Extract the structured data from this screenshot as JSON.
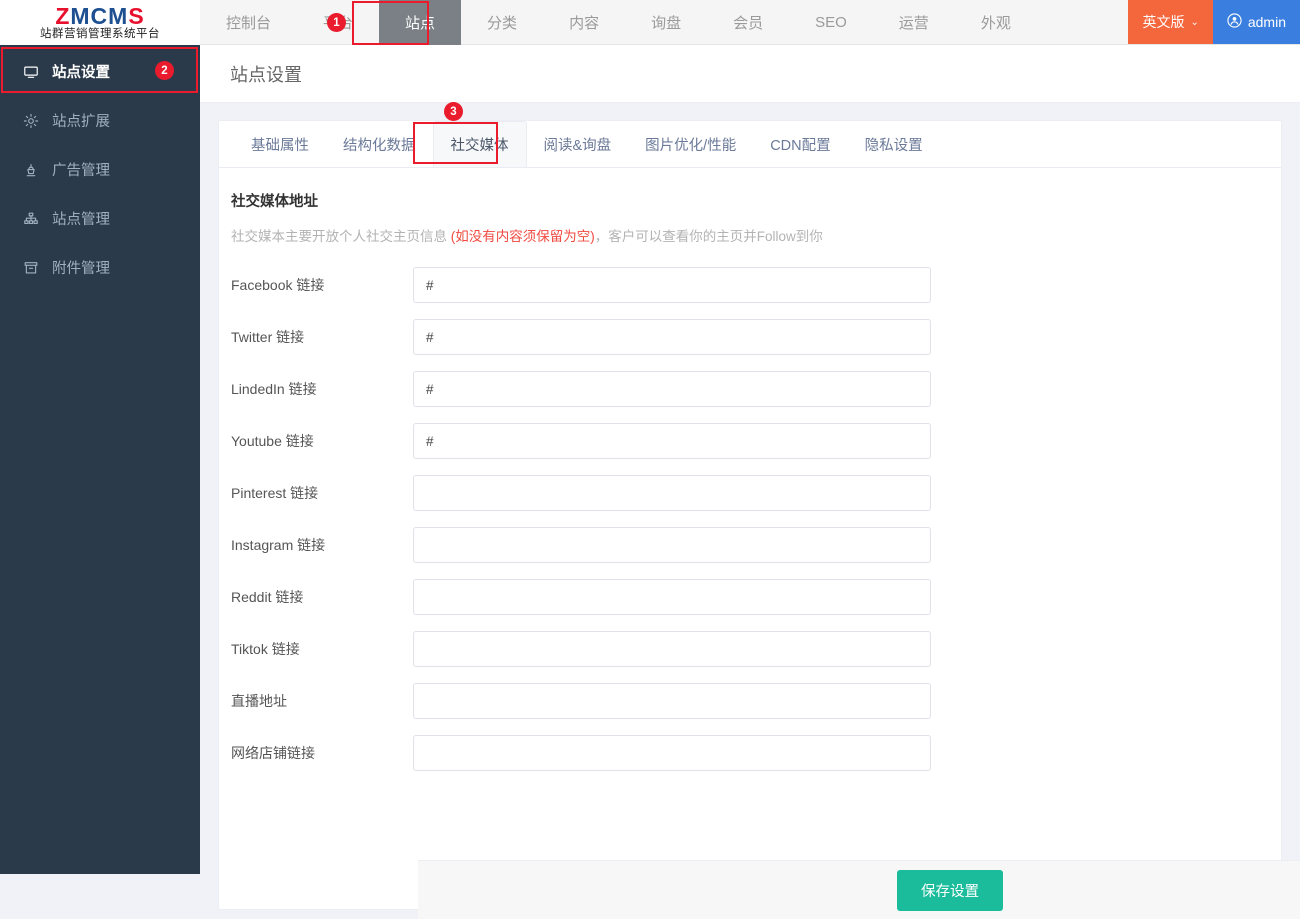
{
  "brand": {
    "logo_z": "Z",
    "logo_mcm": "MCM",
    "logo_s": "S",
    "subtitle": "站群营销管理系统平台"
  },
  "topnav": {
    "items": [
      {
        "label": "控制台",
        "active": false
      },
      {
        "label": "平台",
        "active": false
      },
      {
        "label": "站点",
        "active": true
      },
      {
        "label": "分类",
        "active": false
      },
      {
        "label": "内容",
        "active": false
      },
      {
        "label": "询盘",
        "active": false
      },
      {
        "label": "会员",
        "active": false
      },
      {
        "label": "SEO",
        "active": false
      },
      {
        "label": "运营",
        "active": false
      },
      {
        "label": "外观",
        "active": false
      }
    ],
    "lang_label": "英文版",
    "lang_caret": "⌄",
    "user_label": "admin",
    "user_icon": "user-circle-icon"
  },
  "sidebar": {
    "items": [
      {
        "label": "站点设置",
        "icon": "monitor-icon",
        "active": true
      },
      {
        "label": "站点扩展",
        "icon": "gear-icon",
        "active": false
      },
      {
        "label": "广告管理",
        "icon": "lamp-icon",
        "active": false
      },
      {
        "label": "站点管理",
        "icon": "sitemap-icon",
        "active": false
      },
      {
        "label": "附件管理",
        "icon": "archive-icon",
        "active": false
      }
    ]
  },
  "page": {
    "title": "站点设置"
  },
  "tabs": [
    {
      "label": "基础属性",
      "active": false
    },
    {
      "label": "结构化数据",
      "active": false
    },
    {
      "label": "社交媒体",
      "active": true
    },
    {
      "label": "阅读&询盘",
      "active": false
    },
    {
      "label": "图片优化/性能",
      "active": false
    },
    {
      "label": "CDN配置",
      "active": false
    },
    {
      "label": "隐私设置",
      "active": false
    }
  ],
  "form": {
    "section_title": "社交媒体地址",
    "desc_pre": "社交媒本主要开放个人社交主页信息 ",
    "desc_warn": "(如没有内容须保留为空)",
    "desc_post": "，客户可以查看你的主页并Follow到你",
    "fields": [
      {
        "label": "Facebook 链接",
        "value": "#",
        "placeholder": ""
      },
      {
        "label": "Twitter 链接",
        "value": "#",
        "placeholder": ""
      },
      {
        "label": "LindedIn 链接",
        "value": "#",
        "placeholder": ""
      },
      {
        "label": "Youtube 链接",
        "value": "#",
        "placeholder": ""
      },
      {
        "label": "Pinterest 链接",
        "value": "",
        "placeholder": ""
      },
      {
        "label": "Instagram 链接",
        "value": "",
        "placeholder": ""
      },
      {
        "label": "Reddit 链接",
        "value": "",
        "placeholder": ""
      },
      {
        "label": "Tiktok 链接",
        "value": "",
        "placeholder": ""
      },
      {
        "label": "直播地址",
        "value": "",
        "placeholder": ""
      },
      {
        "label": "网络店铺链接",
        "value": "",
        "placeholder": ""
      }
    ],
    "save_label": "保存设置"
  },
  "annotations": [
    {
      "number": "1"
    },
    {
      "number": "2"
    },
    {
      "number": "3"
    }
  ],
  "colors": {
    "accent_red": "#ea1b2d",
    "sidebar_bg": "#2b3a4a",
    "save_teal": "#1bbc9b",
    "lang_orange": "#f4663c",
    "user_blue": "#3a7fe0"
  }
}
